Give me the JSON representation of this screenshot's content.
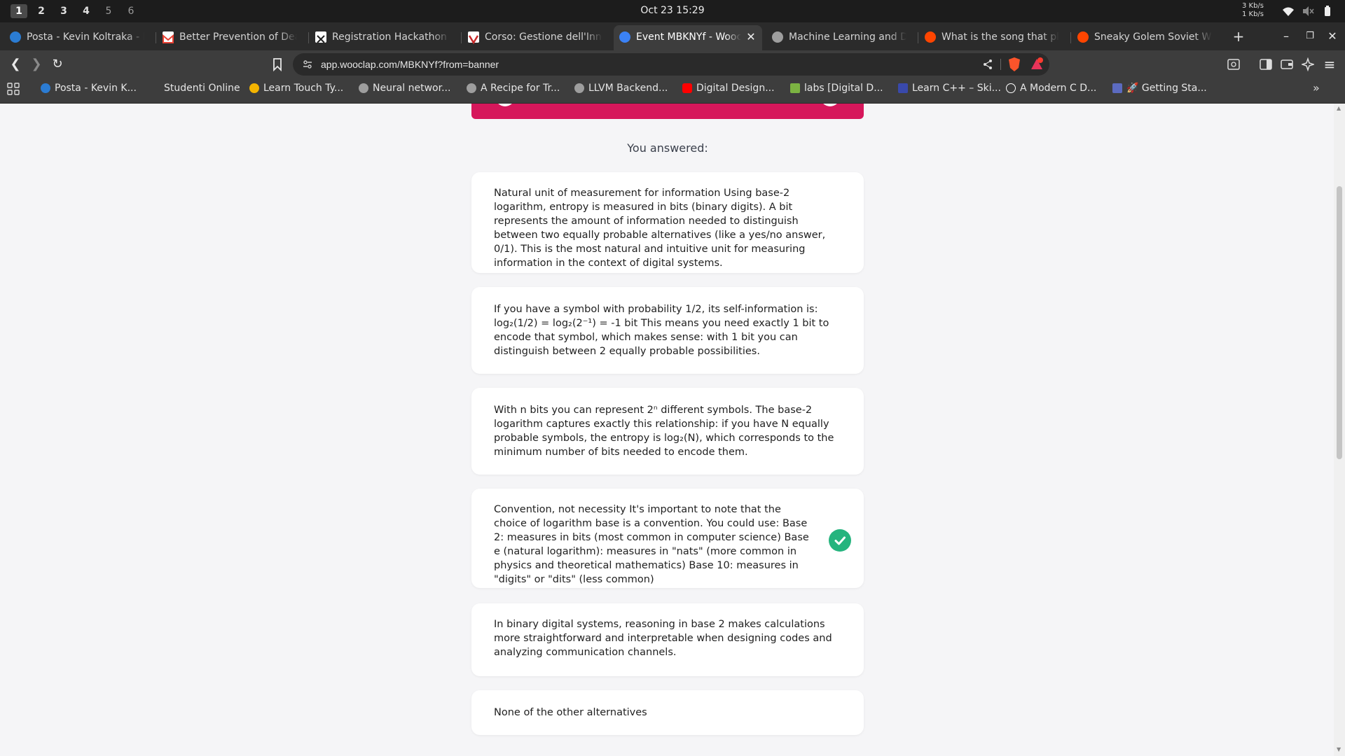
{
  "system": {
    "workspaces": [
      "1",
      "2",
      "3",
      "4",
      "5",
      "6"
    ],
    "active_workspace": "1",
    "clock": "Oct 23  15:29",
    "net_up": "3 Kb/s",
    "net_down": "1 Kb/s"
  },
  "tabs": [
    {
      "title": "Posta - Kevin Koltraka - ke",
      "icon": "outlook-icon",
      "color": "#2b7cd3"
    },
    {
      "title": "Better Prevention of Dea",
      "icon": "gmail-icon",
      "color": "#ea4335"
    },
    {
      "title": "Registration Hackathon C",
      "icon": "x-icon",
      "color": "#ffffff"
    },
    {
      "title": "Corso: Gestione dell'Inno",
      "icon": "moodle-icon",
      "color": "#c62828"
    },
    {
      "title": "Event MBKNYf - Wooc",
      "icon": "wooclap-icon",
      "color": "#3b82f6"
    },
    {
      "title": "Machine Learning and Da",
      "icon": "globe-icon",
      "color": "#9e9e9e"
    },
    {
      "title": "What is the song that pla",
      "icon": "reddit-icon",
      "color": "#ff4500"
    },
    {
      "title": "Sneaky Golem Soviet WW",
      "icon": "reddit-icon",
      "color": "#ff4500"
    }
  ],
  "active_tab": 4,
  "address": {
    "url": "app.wooclap.com/MBKNYf?from=banner"
  },
  "bookmarks": [
    {
      "label": "Posta - Kevin K...",
      "icon": "outlook-icon",
      "color": "#2b7cd3"
    },
    {
      "label": "Studenti Online",
      "icon": "",
      "color": ""
    },
    {
      "label": "Learn Touch Ty...",
      "icon": "typing-icon",
      "color": "#f4b400"
    },
    {
      "label": "Neural networ...",
      "icon": "globe-icon",
      "color": "#9e9e9e"
    },
    {
      "label": "A Recipe for Tr...",
      "icon": "globe-icon",
      "color": "#9e9e9e"
    },
    {
      "label": "LLVM Backend...",
      "icon": "globe-icon",
      "color": "#9e9e9e"
    },
    {
      "label": "Digital Design...",
      "icon": "youtube-icon",
      "color": "#ff0000"
    },
    {
      "label": "labs [Digital D...",
      "icon": "labs-icon",
      "color": "#7cb342"
    },
    {
      "label": "Learn C++ – Ski...",
      "icon": "cpp-icon",
      "color": "#3949ab"
    },
    {
      "label": "A Modern C D...",
      "icon": "eye-icon",
      "color": "#ffffff"
    },
    {
      "label": "🚀 Getting Sta...",
      "icon": "doc-icon",
      "color": "#5c6bc0"
    }
  ],
  "page": {
    "heading": "You answered:",
    "accent": "#d6175b",
    "correct_color": "#25b47e",
    "answers": [
      {
        "text": "Natural unit of measurement for information Using base-2 logarithm, entropy is measured in bits (binary digits). A bit represents the amount of information needed to distinguish between two equally probable alternatives (like a yes/no answer, 0/1). This is the most natural and intuitive unit for measuring information in the context of digital systems.",
        "selected": false
      },
      {
        "text": "If you have a symbol with probability 1/2, its self-information is:  log₂(1/2) = log₂(2⁻¹) = -1 bit  This means you need exactly 1 bit to encode that symbol, which makes sense: with 1 bit you can distinguish between 2 equally probable possibilities.",
        "selected": false
      },
      {
        "text": "With n bits you can represent 2ⁿ different symbols. The base-2 logarithm captures exactly this relationship: if you have N equally probable symbols, the entropy is log₂(N), which corresponds to the minimum number of bits needed to encode them.",
        "selected": false
      },
      {
        "text": "Convention, not necessity It's important to note that the choice of logarithm base is a convention. You could use:  Base 2: measures in bits (most common in computer science) Base e (natural logarithm): measures in \"nats\" (more common in physics and theoretical mathematics) Base 10: measures in \"digits\" or \"dits\" (less common)",
        "selected": true
      },
      {
        "text": "In binary digital systems, reasoning in base 2 makes calculations more straightforward and interpretable when designing codes and analyzing communication channels.",
        "selected": false
      },
      {
        "text": "None of the other alternatives",
        "selected": false
      }
    ]
  }
}
